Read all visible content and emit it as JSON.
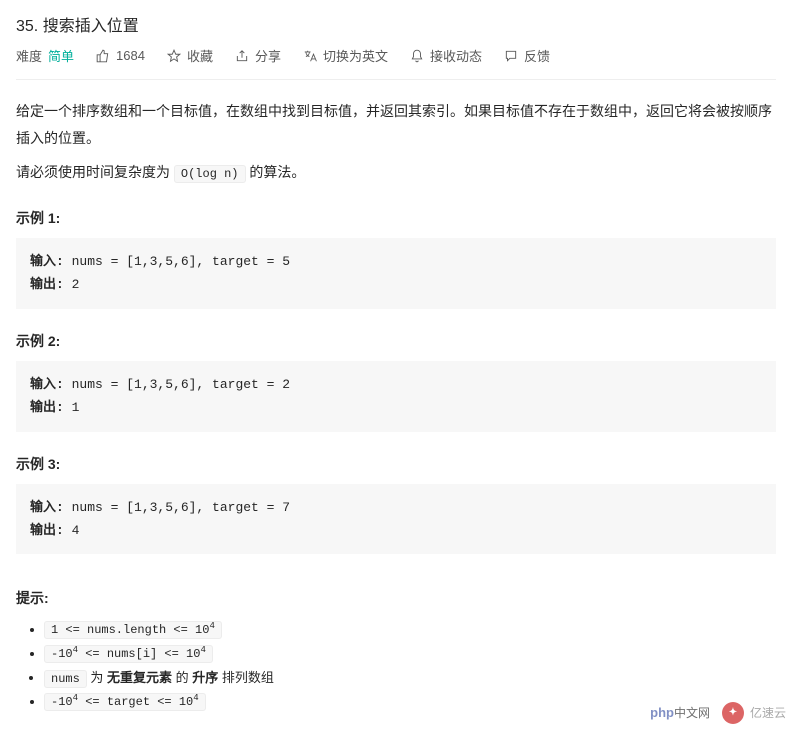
{
  "title": "35. 搜索插入位置",
  "meta": {
    "difficulty_label": "难度",
    "difficulty_value": "简单",
    "likes": "1684",
    "favorite": "收藏",
    "share": "分享",
    "switch_lang": "切换为英文",
    "subscribe": "接收动态",
    "feedback": "反馈"
  },
  "desc": {
    "p1": "给定一个排序数组和一个目标值，在数组中找到目标值，并返回其索引。如果目标值不存在于数组中，返回它将会被按顺序插入的位置。",
    "p2a": "请必须使用时间复杂度为 ",
    "p2code": "O(log n)",
    "p2b": " 的算法。"
  },
  "examples": [
    {
      "label": "示例 1:",
      "input_label": "输入:",
      "input": " nums = [1,3,5,6], target = 5",
      "output_label": "输出:",
      "output": " 2"
    },
    {
      "label": "示例 2:",
      "input_label": "输入:",
      "input": " nums = [1,3,5,6], target = 2",
      "output_label": "输出:",
      "output": " 1"
    },
    {
      "label": "示例 3:",
      "input_label": "输入:",
      "input": " nums = [1,3,5,6], target = 7",
      "output_label": "输出:",
      "output": " 4"
    }
  ],
  "hints": {
    "label": "提示:",
    "items": {
      "h1a": "1 <= nums.length <= 10",
      "h1sup": "4",
      "h2a": "-10",
      "h2sup1": "4",
      "h2b": " <= nums[i] <= 10",
      "h2sup2": "4",
      "h3code": "nums",
      "h3a": " 为 ",
      "h3b": "无重复元素",
      "h3c": " 的 ",
      "h3d": "升序",
      "h3e": " 排列数组",
      "h4a": "-10",
      "h4sup1": "4",
      "h4b": " <= target <= 10",
      "h4sup2": "4"
    }
  },
  "watermark": {
    "php": "php",
    "zh": "中文网",
    "ysy": "亿速云"
  }
}
